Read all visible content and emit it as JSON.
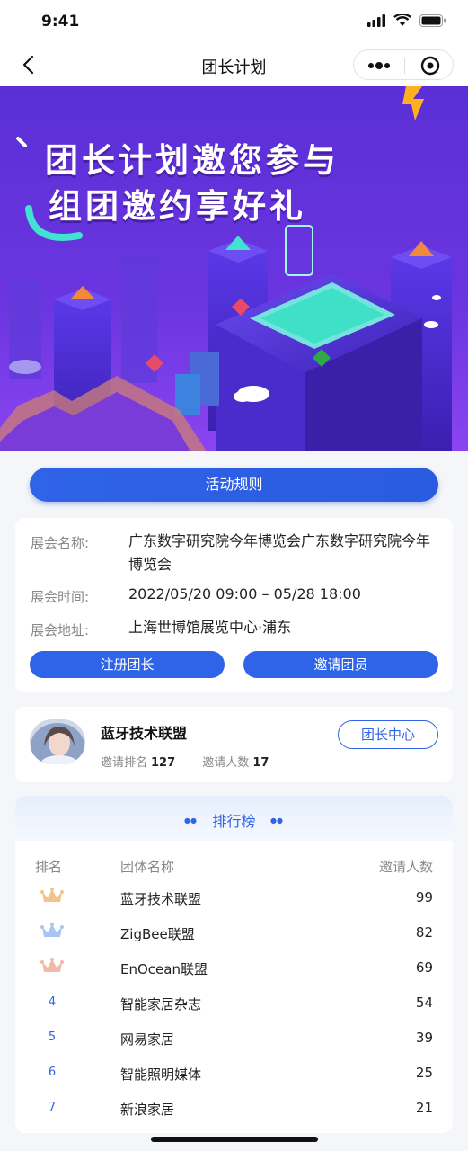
{
  "status_bar": {
    "time": "9:41"
  },
  "nav": {
    "title": "团长计划"
  },
  "banner": {
    "line1": "团长计划邀您参与",
    "line2": "组团邀约享好礼"
  },
  "rules_button": "活动规则",
  "exhibition": {
    "name_label": "展会名称:",
    "name_value": "广东数字研究院今年博览会广东数字研究院今年博览会",
    "time_label": "展会时间:",
    "time_value": "2022/05/20 09:00 – 05/28 18:00",
    "address_label": "展会地址:",
    "address_value": "上海世博馆展览中心·浦东",
    "register_button": "注册团长",
    "invite_button": "邀请团员"
  },
  "leader": {
    "name": "蓝牙技术联盟",
    "rank_label": "邀请排名",
    "rank_value": "127",
    "invited_label": "邀请人数",
    "invited_value": "17",
    "center_button": "团长中心"
  },
  "ranking": {
    "title": "排行榜",
    "columns": {
      "rank": "排名",
      "name": "团体名称",
      "count": "邀请人数"
    },
    "rows": [
      {
        "rank": "1",
        "name": "蓝牙技术联盟",
        "count": "99",
        "crown": "gold"
      },
      {
        "rank": "2",
        "name": "ZigBee联盟",
        "count": "82",
        "crown": "silver"
      },
      {
        "rank": "3",
        "name": "EnOcean联盟",
        "count": "69",
        "crown": "bronze"
      },
      {
        "rank": "4",
        "name": "智能家居杂志",
        "count": "54"
      },
      {
        "rank": "5",
        "name": "网易家居",
        "count": "39"
      },
      {
        "rank": "6",
        "name": "智能照明媒体",
        "count": "25"
      },
      {
        "rank": "7",
        "name": "新浪家居",
        "count": "21"
      }
    ]
  },
  "colors": {
    "primary": "#2f63e8",
    "banner_top": "#5a2fd6",
    "banner_bottom": "#7b3fe8"
  }
}
